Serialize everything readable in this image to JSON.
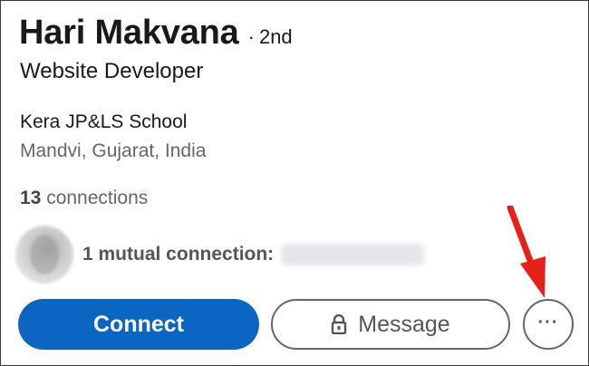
{
  "profile": {
    "name": "Hari Makvana",
    "degree_dot": "·",
    "degree": "2nd",
    "headline": "Website Developer",
    "school": "Kera JP&LS School",
    "location": "Mandvi, Gujarat, India",
    "connections_count": "13",
    "connections_label": "connections",
    "mutual_label": "1 mutual connection:"
  },
  "actions": {
    "connect_label": "Connect",
    "message_label": "Message",
    "more_label": "···"
  },
  "colors": {
    "primary": "#0a66c2",
    "annotation_arrow": "#e8201a"
  },
  "icons": {
    "message_button": "lock-icon",
    "annotation": "red-arrow-icon"
  }
}
